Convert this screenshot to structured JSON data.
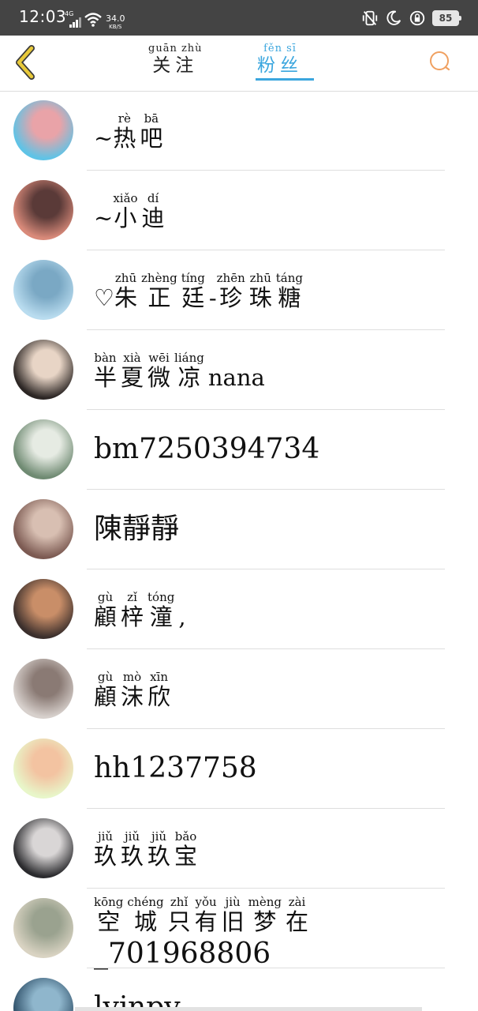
{
  "status_bar": {
    "time": "12:03",
    "signal": "4G",
    "speed": "34.0",
    "speed_unit": "KB/S",
    "battery": "85"
  },
  "nav": {
    "tab_follow": {
      "pinyin": "guān zhù",
      "label": "关注"
    },
    "tab_fans": {
      "pinyin": "fěn sī",
      "label": "粉丝"
    },
    "active_tab": "fans",
    "accent_color": "#3ba6de",
    "back_icon_color": "#e8c93a",
    "search_icon_color": "#f0a060"
  },
  "followers": [
    {
      "segments": [
        {
          "t": "~"
        },
        {
          "py": "rè",
          "hz": "热"
        },
        {
          "py": "bā",
          "hz": "吧"
        }
      ],
      "avatar_colors": [
        "#5fc3e6",
        "#e9a3a8"
      ]
    },
    {
      "segments": [
        {
          "t": "~"
        },
        {
          "py": "xiǎo",
          "hz": "小"
        },
        {
          "py": "dí",
          "hz": "迪"
        }
      ],
      "avatar_colors": [
        "#d98a7a",
        "#5a3a38"
      ]
    },
    {
      "segments": [
        {
          "t": "♡"
        },
        {
          "py": "zhū",
          "hz": "朱"
        },
        {
          "py": "zhèng",
          "hz": "正"
        },
        {
          "py": "tíng",
          "hz": "廷"
        },
        {
          "t": "-"
        },
        {
          "py": "zhēn",
          "hz": "珍"
        },
        {
          "py": "zhū",
          "hz": "珠"
        },
        {
          "py": "táng",
          "hz": "糖"
        }
      ],
      "avatar_colors": [
        "#b9dcef",
        "#7aa8c4"
      ]
    },
    {
      "segments": [
        {
          "py": "bàn",
          "hz": "半"
        },
        {
          "py": "xià",
          "hz": "夏"
        },
        {
          "py": "wēi",
          "hz": "微"
        },
        {
          "py": "liáng",
          "hz": "凉"
        },
        {
          "t": "nana"
        }
      ],
      "avatar_colors": [
        "#2c2624",
        "#e8d5c6"
      ]
    },
    {
      "segments": [
        {
          "t": "bm7250394734"
        }
      ],
      "avatar_colors": [
        "#6f8a72",
        "#e6ebe3"
      ]
    },
    {
      "segments": [
        {
          "t": "陳靜靜"
        }
      ],
      "avatar_colors": [
        "#7c5a52",
        "#d8bfb2"
      ]
    },
    {
      "segments": [
        {
          "py": "gù",
          "hz": "顧"
        },
        {
          "py": "zǐ",
          "hz": "梓"
        },
        {
          "py": "tóng",
          "hz": "潼"
        },
        {
          "t": ","
        }
      ],
      "avatar_colors": [
        "#3b2f2c",
        "#c98e68"
      ]
    },
    {
      "segments": [
        {
          "py": "gù",
          "hz": "顧"
        },
        {
          "py": "mò",
          "hz": "沫"
        },
        {
          "py": "xīn",
          "hz": "欣"
        }
      ],
      "avatar_colors": [
        "#d7d0cc",
        "#8a7a74"
      ]
    },
    {
      "segments": [
        {
          "t": "hh1237758"
        }
      ],
      "avatar_colors": [
        "#e8f6c9",
        "#f3c3a1"
      ]
    },
    {
      "segments": [
        {
          "py": "jiǔ",
          "hz": "玖"
        },
        {
          "py": "jiǔ",
          "hz": "玖"
        },
        {
          "py": "jiǔ",
          "hz": "玖"
        },
        {
          "py": "bǎo",
          "hz": "宝"
        }
      ],
      "avatar_colors": [
        "#2b2b2e",
        "#d9d6d6"
      ]
    },
    {
      "segments": [
        {
          "py": "kōng",
          "hz": "空"
        },
        {
          "py": "chéng",
          "hz": "城"
        },
        {
          "py": "zhǐ",
          "hz": "只"
        },
        {
          "py": "yǒu",
          "hz": "有"
        },
        {
          "py": "jiù",
          "hz": "旧"
        },
        {
          "py": "mèng",
          "hz": "梦"
        },
        {
          "py": "zài",
          "hz": "在"
        }
      ],
      "line2": "_701968806",
      "avatar_colors": [
        "#d9d3c2",
        "#9aa28f"
      ]
    },
    {
      "segments": [
        {
          "t": "lyjnpy"
        }
      ],
      "avatar_colors": [
        "#2e4f68",
        "#8fb6cc"
      ]
    }
  ]
}
